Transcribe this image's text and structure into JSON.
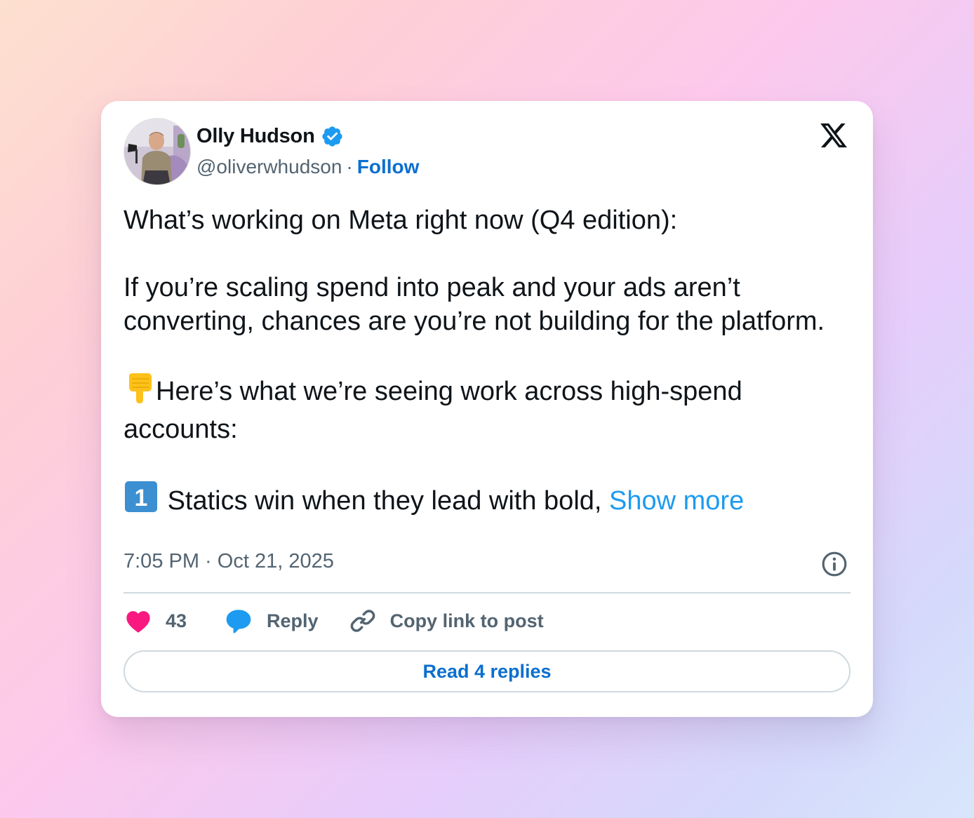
{
  "author": {
    "name": "Olly Hudson",
    "handle": "@oliverwhudson",
    "separator": "·",
    "follow_label": "Follow",
    "verified": true
  },
  "post": {
    "paragraphs": [
      "What’s working on Meta right now (Q4 edition):",
      "If you’re scaling spend into peak and your ads aren’t converting, chances are you’re not building for the platform.",
      "Here’s what we’re seeing work across high-spend accounts:",
      "Statics win when they lead with bold,"
    ],
    "emoji_point_down": "👇",
    "emoji_keycap_one": "1",
    "show_more_label": "Show more",
    "timestamp": "7:05 PM · Oct 21, 2025"
  },
  "actions": {
    "likes_count": "43",
    "reply_label": "Reply",
    "copy_link_label": "Copy link to post",
    "read_replies_label": "Read 4 replies"
  },
  "icons": {
    "platform_logo": "x-logo-icon",
    "verified": "verified-badge-icon",
    "info": "info-icon",
    "like": "heart-icon",
    "reply": "speech-bubble-icon",
    "copy_link": "link-icon"
  },
  "colors": {
    "text_primary": "#0f1419",
    "text_secondary": "#536471",
    "follow_blue": "#0b6fcf",
    "show_more_blue": "#1d9bf0",
    "heart_pink": "#f91880",
    "reply_blue": "#1d9bf0",
    "divider": "#cfd9de"
  }
}
